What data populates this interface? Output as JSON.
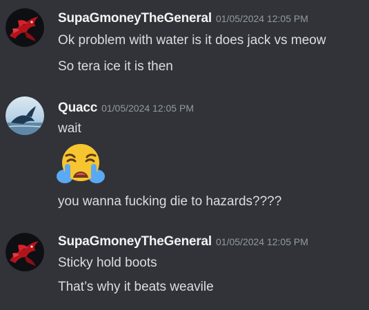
{
  "colors": {
    "background": "#313338",
    "username": "#f2f3f5",
    "message_text": "#dbdee1",
    "timestamp": "#949ba4"
  },
  "messages": [
    {
      "avatar_icon": "red-dragon-avatar-icon",
      "username": "SupaGmoneyTheGeneral",
      "timestamp": "01/05/2024 12:05 PM",
      "lines": [
        "Ok problem with water is it does jack vs meow",
        "So tera ice it is then"
      ]
    },
    {
      "avatar_icon": "whale-sky-avatar-icon",
      "username": "Quacc",
      "timestamp": "01/05/2024 12:05 PM",
      "lines": [
        "wait",
        "you wanna fucking die to hazards????"
      ],
      "emoji": "loudly-crying-face-emoji"
    },
    {
      "avatar_icon": "red-dragon-avatar-icon",
      "username": "SupaGmoneyTheGeneral",
      "timestamp": "01/05/2024 12:05 PM",
      "lines": [
        "Sticky hold boots",
        "That’s why it beats weavile"
      ]
    }
  ]
}
